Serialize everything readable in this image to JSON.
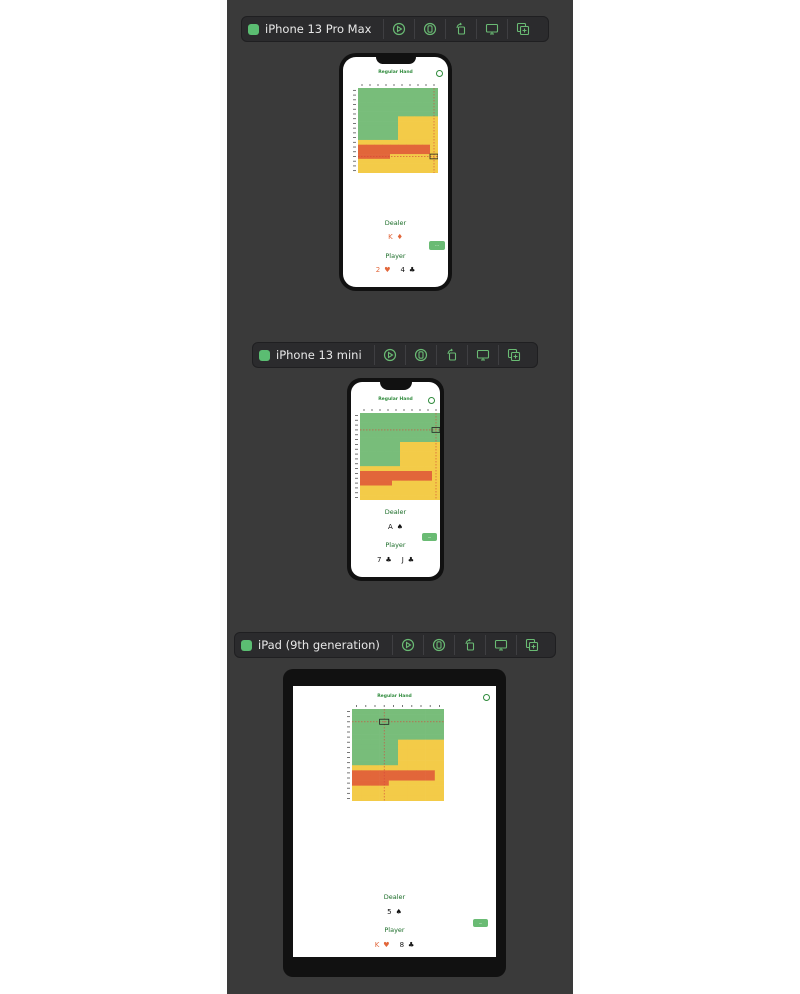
{
  "devices": [
    {
      "id": "pro-max",
      "name": "iPhone 13 Pro Max",
      "app_title": "Regular Hand",
      "chart": {
        "current_col": 9,
        "current_row": 14
      },
      "dealer_label": "Dealer",
      "player_label": "Player",
      "dealer_card": {
        "rank": "K",
        "suit": "♦",
        "color": "red"
      },
      "player_cards": [
        {
          "rank": "2",
          "suit": "♥",
          "color": "red"
        },
        {
          "rank": "4",
          "suit": "♣",
          "color": "black"
        }
      ],
      "action_label": "···"
    },
    {
      "id": "mini",
      "name": "iPhone 13 mini",
      "app_title": "Regular Hand",
      "chart": {
        "current_col": 9,
        "current_row": 3
      },
      "dealer_label": "Dealer",
      "player_label": "Player",
      "dealer_card": {
        "rank": "A",
        "suit": "♠",
        "color": "black"
      },
      "player_cards": [
        {
          "rank": "7",
          "suit": "♣",
          "color": "black"
        },
        {
          "rank": "J",
          "suit": "♣",
          "color": "black"
        }
      ],
      "action_label": "···"
    },
    {
      "id": "ipad",
      "name": "iPad (9th generation)",
      "app_title": "Regular Hand",
      "chart": {
        "current_col": 3,
        "current_row": 2
      },
      "dealer_label": "Dealer",
      "player_label": "Player",
      "dealer_card": {
        "rank": "5",
        "suit": "♠",
        "color": "black"
      },
      "player_cards": [
        {
          "rank": "K",
          "suit": "♥",
          "color": "red"
        },
        {
          "rank": "8",
          "suit": "♣",
          "color": "black"
        }
      ],
      "action_label": "···"
    }
  ],
  "colors": {
    "hit": "#78bd7a",
    "stand": "#f3cb48",
    "double": "#e2663a",
    "accent": "#2e8a3b"
  },
  "chart_strategy": {
    "cols": 10,
    "rows": 18,
    "stand": [
      [
        0,
        0,
        0,
        0,
        0,
        0,
        0,
        0,
        0,
        0
      ],
      [
        0,
        0,
        0,
        0,
        0,
        0,
        0,
        0,
        0,
        0
      ],
      [
        0,
        0,
        0,
        0,
        0,
        0,
        0,
        0,
        0,
        0
      ],
      [
        0,
        0,
        0,
        0,
        0,
        0,
        0,
        0,
        0,
        0
      ],
      [
        0,
        0,
        0,
        0,
        0,
        0,
        0,
        0,
        0,
        0
      ],
      [
        0,
        0,
        0,
        0,
        0,
        0,
        0,
        0,
        0,
        0
      ],
      [
        0,
        0,
        0,
        0,
        0,
        1,
        1,
        1,
        1,
        1
      ],
      [
        0,
        0,
        0,
        0,
        0,
        1,
        1,
        1,
        1,
        1
      ],
      [
        0,
        0,
        0,
        0,
        0,
        1,
        1,
        1,
        1,
        1
      ],
      [
        0,
        0,
        0,
        0,
        0,
        1,
        1,
        1,
        1,
        1
      ],
      [
        0,
        0,
        0,
        0,
        0,
        1,
        1,
        1,
        1,
        1
      ],
      [
        1,
        1,
        1,
        1,
        1,
        1,
        1,
        1,
        1,
        1
      ],
      [
        1,
        1,
        1,
        1,
        1,
        1,
        1,
        1,
        1,
        1
      ],
      [
        1,
        1,
        1,
        1,
        1,
        1,
        1,
        1,
        1,
        1
      ],
      [
        1,
        1,
        1,
        1,
        1,
        1,
        1,
        1,
        1,
        1
      ],
      [
        1,
        1,
        1,
        1,
        1,
        1,
        1,
        1,
        1,
        1
      ],
      [
        1,
        1,
        1,
        1,
        1,
        1,
        1,
        1,
        1,
        1
      ],
      [
        1,
        1,
        1,
        1,
        1,
        1,
        1,
        1,
        1,
        1
      ]
    ],
    "double": [
      [
        0,
        0,
        0,
        0,
        0,
        0,
        0,
        0,
        0,
        0
      ],
      [
        0,
        0,
        0,
        0,
        0,
        0,
        0,
        0,
        0,
        0
      ],
      [
        0,
        0,
        0,
        0,
        0,
        0,
        0,
        0,
        0,
        0
      ],
      [
        0,
        0,
        0,
        0,
        0,
        0,
        0,
        0,
        0,
        0
      ],
      [
        0,
        0,
        0,
        0,
        0,
        0,
        0,
        0,
        0,
        0
      ],
      [
        0,
        0,
        0,
        0,
        0,
        0,
        0,
        0,
        0,
        0
      ],
      [
        0,
        0,
        0,
        0,
        0,
        0,
        0,
        0,
        0,
        0
      ],
      [
        0,
        0,
        0,
        0,
        0,
        0,
        0,
        0,
        0,
        0
      ],
      [
        0,
        0,
        0,
        0,
        0,
        0,
        0,
        0,
        0,
        0
      ],
      [
        0,
        0,
        0,
        0,
        0,
        0,
        0,
        0,
        0,
        0
      ],
      [
        0,
        0,
        0,
        0,
        0,
        0,
        0,
        0,
        0,
        0
      ],
      [
        0,
        0,
        0,
        0,
        0,
        0,
        0,
        0,
        0,
        0
      ],
      [
        1,
        1,
        1,
        1,
        1,
        1,
        1,
        1,
        1,
        0
      ],
      [
        1,
        1,
        1,
        1,
        1,
        1,
        1,
        1,
        1,
        0
      ],
      [
        1,
        1,
        1,
        1,
        0,
        0,
        0,
        0,
        0,
        0
      ],
      [
        0,
        0,
        0,
        0,
        0,
        0,
        0,
        0,
        0,
        0
      ],
      [
        0,
        0,
        0,
        0,
        0,
        0,
        0,
        0,
        0,
        0
      ],
      [
        0,
        0,
        0,
        0,
        0,
        0,
        0,
        0,
        0,
        0
      ]
    ]
  }
}
